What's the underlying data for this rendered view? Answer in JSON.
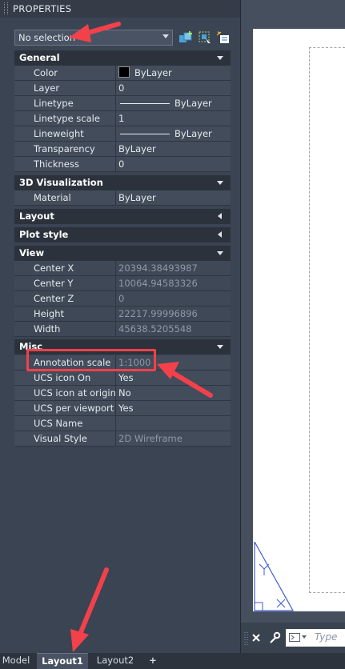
{
  "palette": {
    "title": "PROPERTIES",
    "selection": "No selection",
    "toolbar_icons": [
      "toggle-pickadd-icon",
      "select-objects-icon",
      "quick-select-icon"
    ]
  },
  "sections": {
    "general": {
      "label": "General",
      "rows": [
        {
          "name": "Color",
          "value": "ByLayer"
        },
        {
          "name": "Layer",
          "value": "0"
        },
        {
          "name": "Linetype",
          "value": "ByLayer"
        },
        {
          "name": "Linetype scale",
          "value": "1"
        },
        {
          "name": "Lineweight",
          "value": "ByLayer"
        },
        {
          "name": "Transparency",
          "value": "ByLayer"
        },
        {
          "name": "Thickness",
          "value": "0"
        }
      ]
    },
    "viz3d": {
      "label": "3D Visualization",
      "rows": [
        {
          "name": "Material",
          "value": "ByLayer"
        }
      ]
    },
    "layout": {
      "label": "Layout"
    },
    "plot_style": {
      "label": "Plot style"
    },
    "view": {
      "label": "View",
      "rows": [
        {
          "name": "Center X",
          "value": "20394.38493987"
        },
        {
          "name": "Center Y",
          "value": "10064.94583326"
        },
        {
          "name": "Center Z",
          "value": "0"
        },
        {
          "name": "Height",
          "value": "22217.99996896"
        },
        {
          "name": "Width",
          "value": "45638.5205548"
        }
      ]
    },
    "misc": {
      "label": "Misc",
      "rows": [
        {
          "name": "Annotation scale",
          "value": "1:1000"
        },
        {
          "name": "UCS icon On",
          "value": "Yes"
        },
        {
          "name": "UCS icon at origin",
          "value": "No"
        },
        {
          "name": "UCS per viewport",
          "value": "Yes"
        },
        {
          "name": "UCS Name",
          "value": ""
        },
        {
          "name": "Visual Style",
          "value": "2D Wireframe"
        }
      ]
    }
  },
  "command_line": {
    "placeholder": "Type"
  },
  "tabs": [
    "Model",
    "Layout1",
    "Layout2",
    "+"
  ],
  "active_tab": "Layout1",
  "colors": {
    "highlight": "#f2414b",
    "panel_bg": "#3b4453",
    "section_header_bg": "#2c323c"
  }
}
